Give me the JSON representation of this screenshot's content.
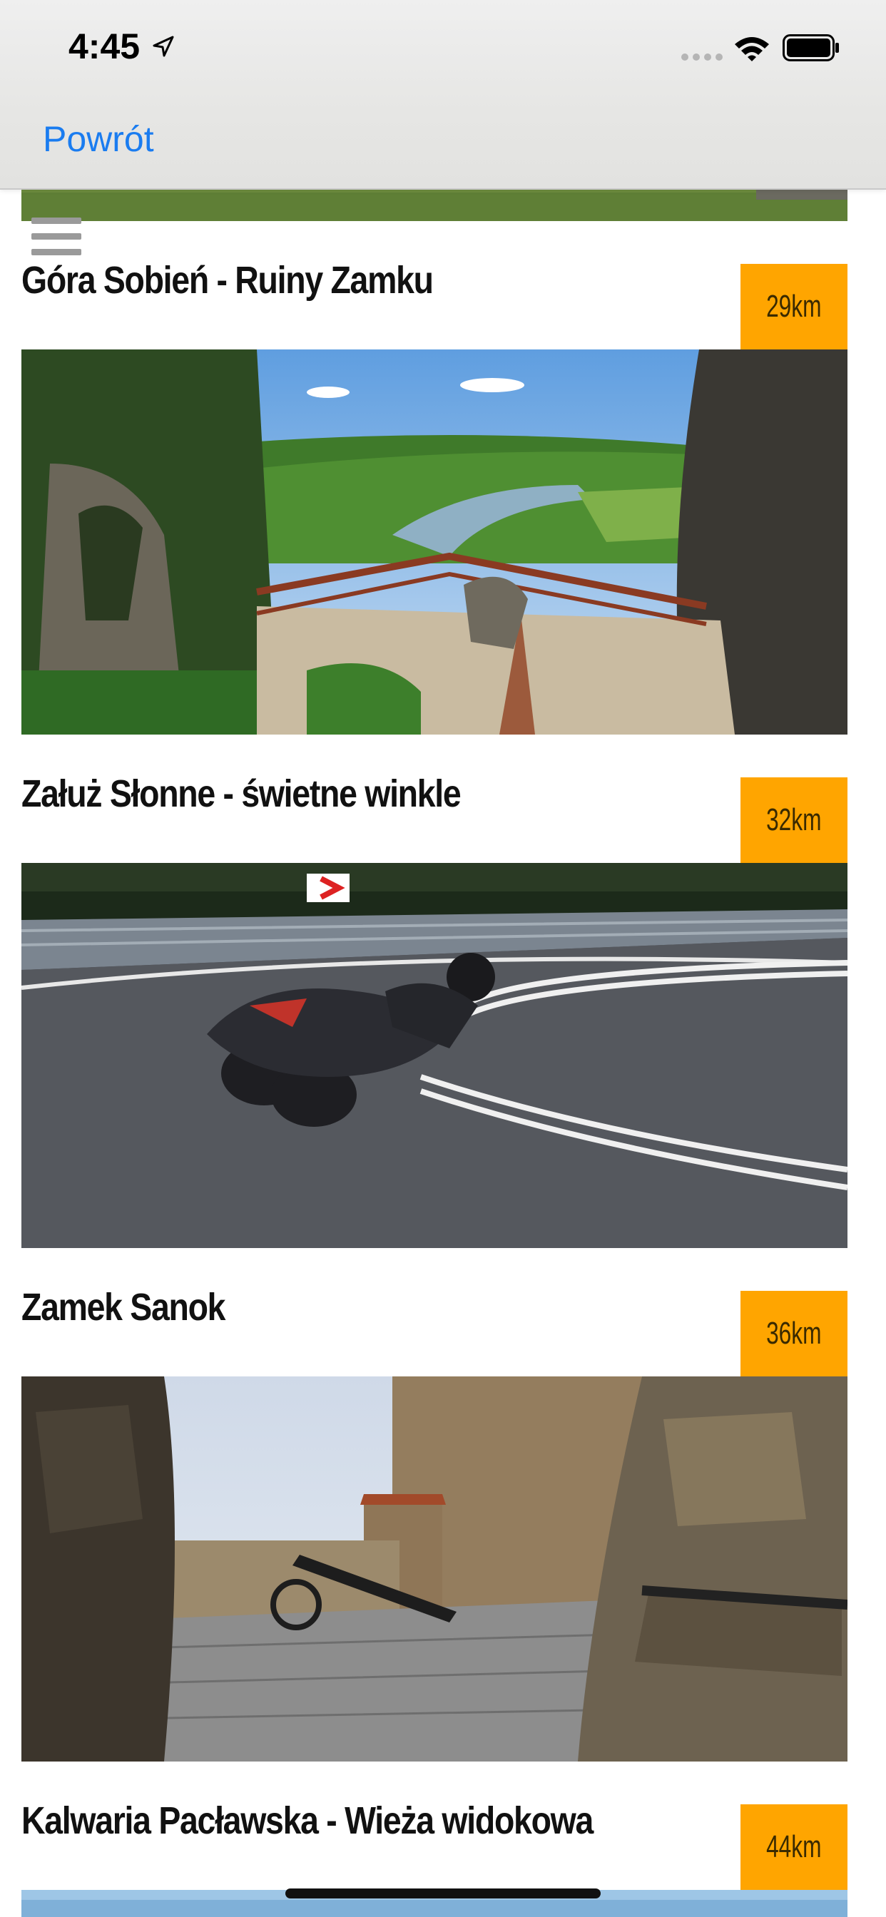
{
  "status_bar": {
    "time": "4:45"
  },
  "nav": {
    "back_label": "Powrót"
  },
  "items": [
    {
      "title": "Góra Sobień - Ruiny Zamku",
      "distance": "29km",
      "image": "castle-ruins-viewpoint"
    },
    {
      "title": "Załuż Słonne - świetne winkle",
      "distance": "32km",
      "image": "motorcycle-curve"
    },
    {
      "title": "Zamek Sanok",
      "distance": "36km",
      "image": "castle-courtyard-cannon"
    },
    {
      "title": "Kalwaria Pacławska - Wieża widokowa",
      "distance": "44km",
      "image": "viewing-tower"
    }
  ],
  "colors": {
    "badge": "#FFA500",
    "link": "#1a7cf0"
  }
}
